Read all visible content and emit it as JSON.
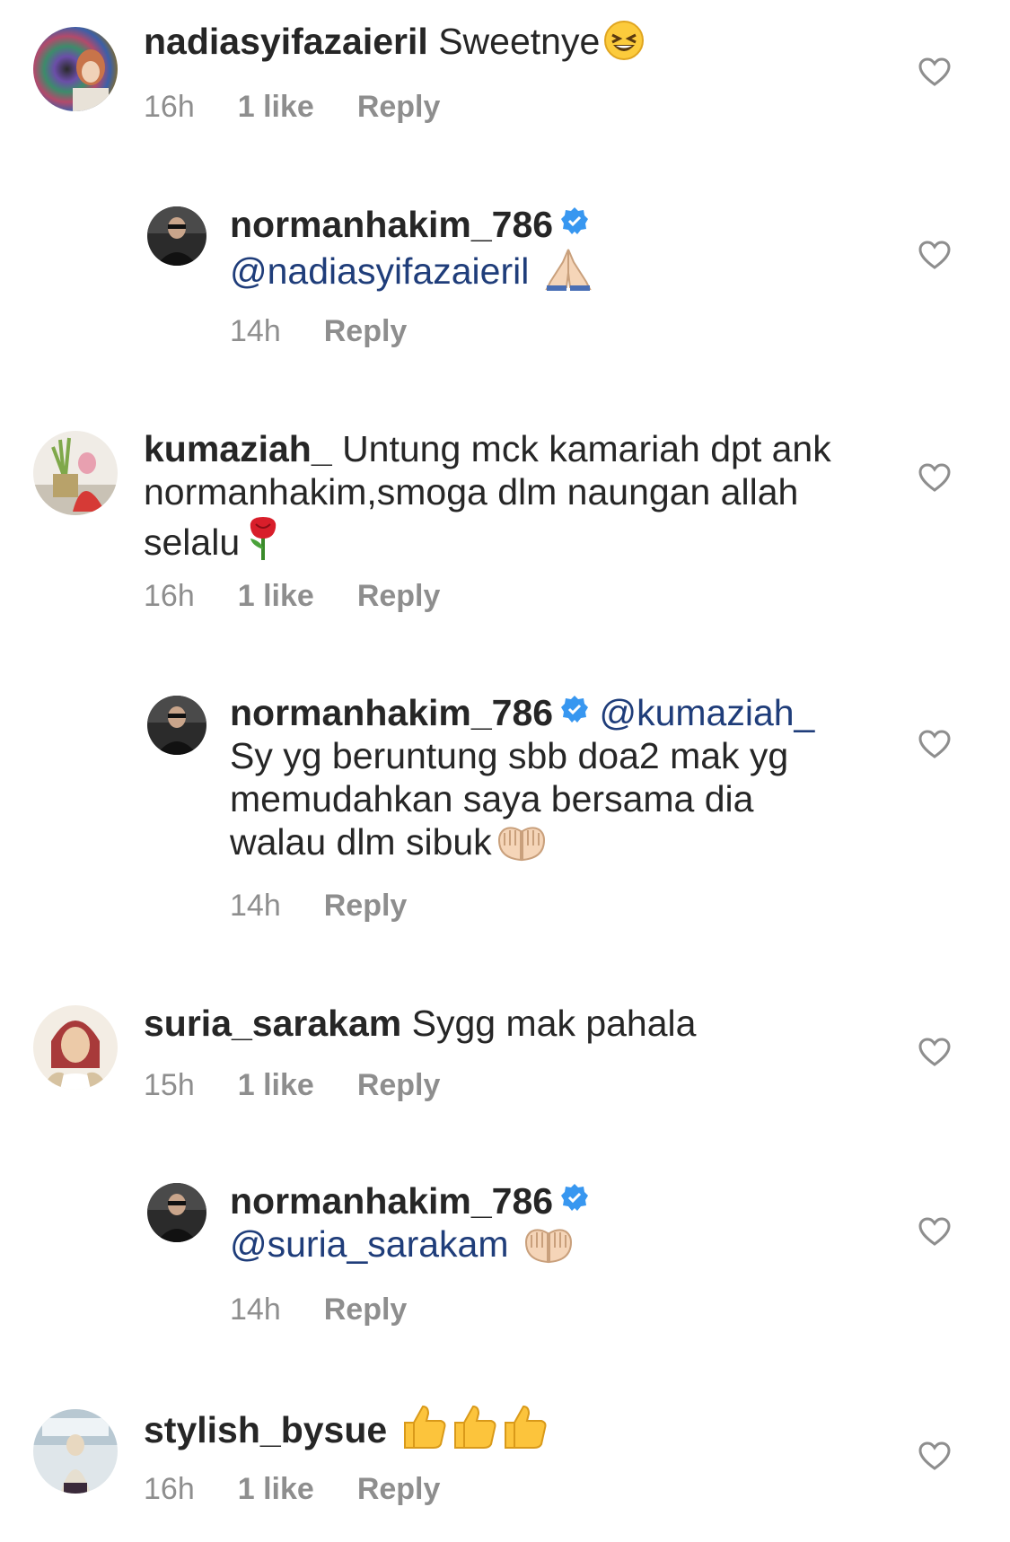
{
  "comments": [
    {
      "username": "nadiasyifazaieril",
      "text": "Sweetnye",
      "emoji": "grinning-squinting-face",
      "time": "16h",
      "likes": "1 like",
      "reply": "Reply",
      "replies": [
        {
          "username": "normanhakim_786",
          "verified": true,
          "mention": "@nadiasyifazaieril",
          "text": "",
          "emoji": "folded-hands",
          "time": "14h",
          "reply": "Reply"
        }
      ]
    },
    {
      "username": "kumaziah_",
      "text": "Untung mck kamariah dpt ank normanhakim,smoga dlm naungan allah selalu",
      "emoji": "rose",
      "time": "16h",
      "likes": "1 like",
      "reply": "Reply",
      "replies": [
        {
          "username": "normanhakim_786",
          "verified": true,
          "mention": "@kumaziah_",
          "text": "Sy yg beruntung sbb doa2 mak yg memudahkan saya bersama dia walau dlm sibuk",
          "emoji": "palms-up-together",
          "time": "14h",
          "reply": "Reply"
        }
      ]
    },
    {
      "username": "suria_sarakam",
      "text": "Sygg mak pahala",
      "emoji": "",
      "time": "15h",
      "likes": "1 like",
      "reply": "Reply",
      "replies": [
        {
          "username": "normanhakim_786",
          "verified": true,
          "mention": "@suria_sarakam",
          "text": "",
          "emoji": "palms-up-together",
          "time": "14h",
          "reply": "Reply"
        }
      ]
    },
    {
      "username": "stylish_bysue",
      "text": "",
      "emoji": "thumbs-up x3",
      "time": "16h",
      "likes": "1 like",
      "reply": "Reply",
      "replies": []
    }
  ],
  "icons": {
    "like": "heart-outline-icon",
    "verified": "verified-badge-icon"
  },
  "colors": {
    "text": "#262626",
    "meta": "#8e8e8e",
    "mention": "#1f3d7a",
    "verified": "#3897f0"
  }
}
